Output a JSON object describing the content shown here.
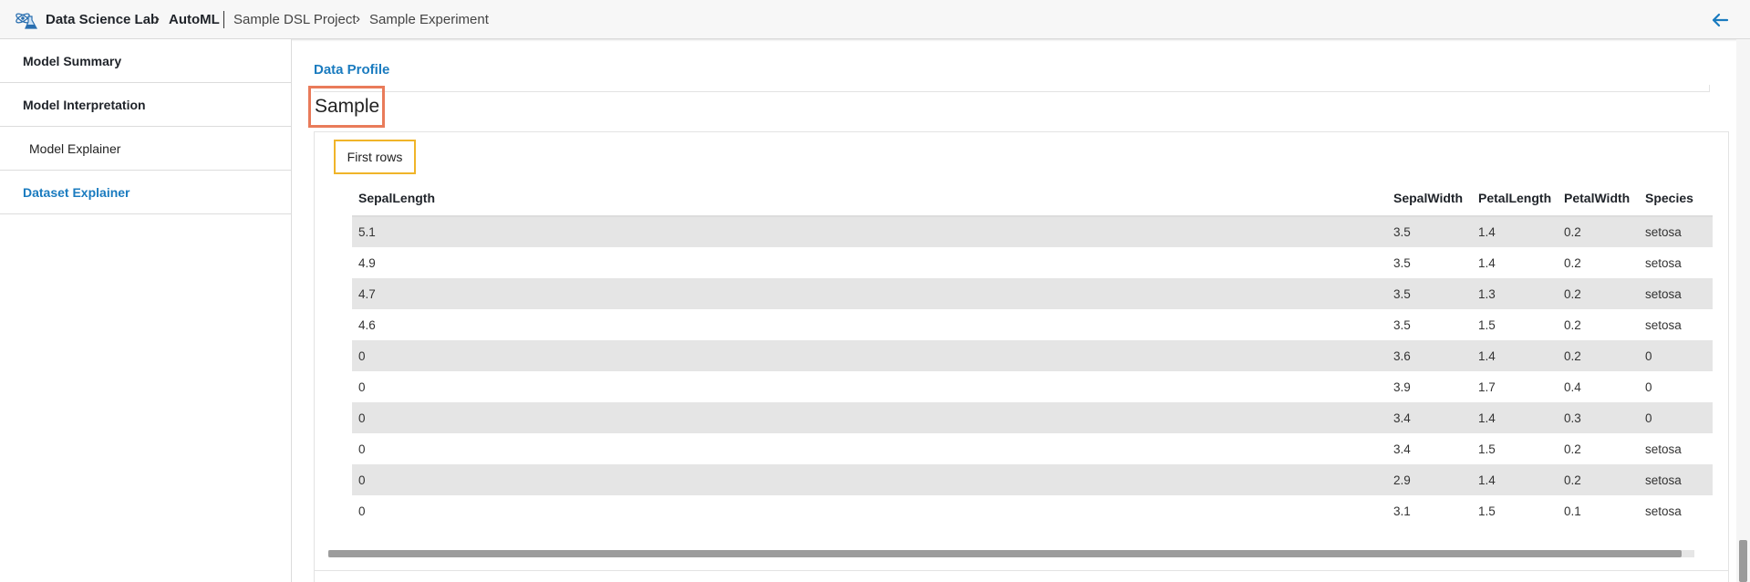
{
  "header": {
    "breadcrumbs": [
      {
        "label": "Data Science Lab"
      },
      {
        "label": "AutoML"
      },
      {
        "label": "Sample DSL Project"
      },
      {
        "label": "Sample Experiment"
      }
    ],
    "logo_icon": "flask-atom-icon",
    "back_icon": "arrow-left-icon",
    "accent_color": "#1a7bbf"
  },
  "sidebar": {
    "items": [
      {
        "label": "Model Summary"
      },
      {
        "label": "Model Interpretation"
      },
      {
        "label": "Model Explainer"
      },
      {
        "label": "Dataset Explainer",
        "active": true
      }
    ]
  },
  "main": {
    "profile_link": "Data Profile",
    "section_title": "Sample",
    "subsection_title": "First rows",
    "table": {
      "columns": [
        "SepalLength",
        "SepalWidth",
        "PetalLength",
        "PetalWidth",
        "Species"
      ],
      "rows": [
        [
          "5.1",
          "3.5",
          "1.4",
          "0.2",
          "setosa"
        ],
        [
          "4.9",
          "3.5",
          "1.4",
          "0.2",
          "setosa"
        ],
        [
          "4.7",
          "3.5",
          "1.3",
          "0.2",
          "setosa"
        ],
        [
          "4.6",
          "3.5",
          "1.5",
          "0.2",
          "setosa"
        ],
        [
          "0",
          "3.6",
          "1.4",
          "0.2",
          "0"
        ],
        [
          "0",
          "3.9",
          "1.7",
          "0.4",
          "0"
        ],
        [
          "0",
          "3.4",
          "1.4",
          "0.3",
          "0"
        ],
        [
          "0",
          "3.4",
          "1.5",
          "0.2",
          "setosa"
        ],
        [
          "0",
          "2.9",
          "1.4",
          "0.2",
          "setosa"
        ],
        [
          "0",
          "3.1",
          "1.5",
          "0.1",
          "setosa"
        ]
      ]
    },
    "highlight_colors": {
      "section": "#e97b5a",
      "subsection": "#f0b429"
    }
  }
}
